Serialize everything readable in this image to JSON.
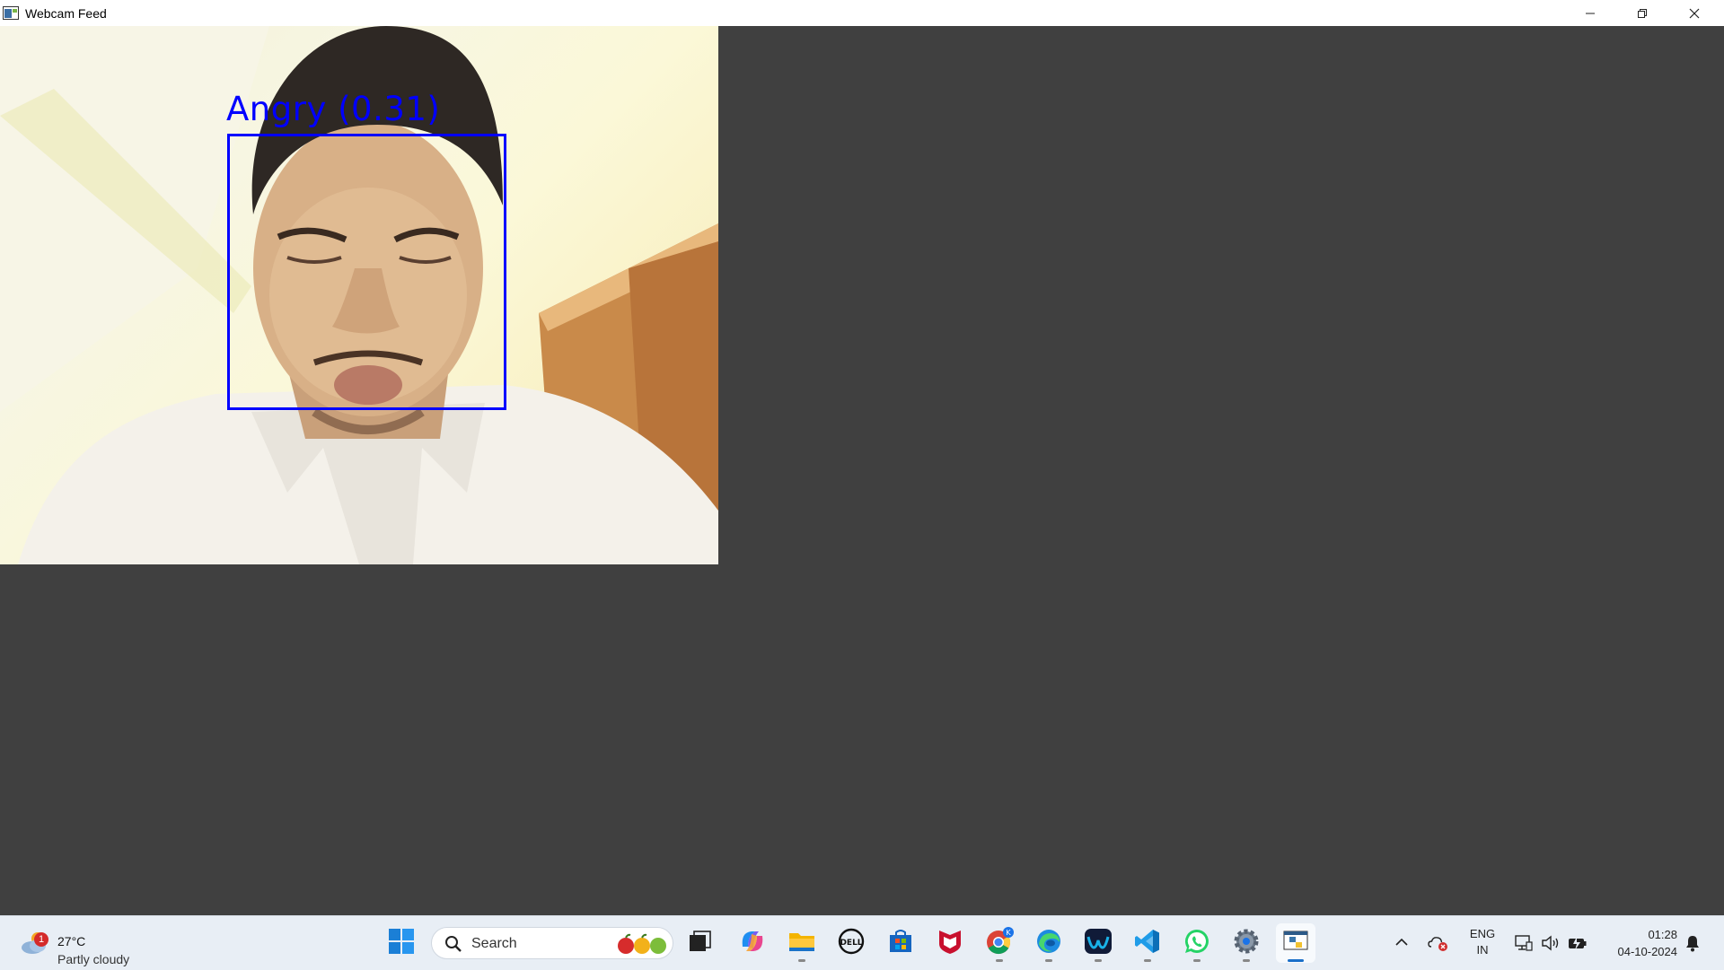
{
  "window": {
    "title": "Webcam Feed",
    "controls": [
      "minimize-icon",
      "restore-icon",
      "close-icon"
    ]
  },
  "feed": {
    "detection_label": "Angry (0.31)",
    "box_color": "#0000ff"
  },
  "taskbar": {
    "weather": {
      "badge": "1",
      "temperature": "27°C",
      "condition": "Partly cloudy"
    },
    "search": {
      "placeholder": "Search"
    },
    "apps": [
      "windows-start-icon",
      "task-view-icon",
      "copilot-icon",
      "file-explorer-icon",
      "dell-icon",
      "microsoft-store-icon",
      "mcafee-icon",
      "chrome-icon",
      "edge-icon",
      "webex-icon",
      "vscode-icon",
      "whatsapp-icon",
      "settings-icon",
      "python-app-icon"
    ],
    "tray": {
      "language_line1": "ENG",
      "language_line2": "IN",
      "time": "01:28",
      "date": "04-10-2024"
    }
  }
}
